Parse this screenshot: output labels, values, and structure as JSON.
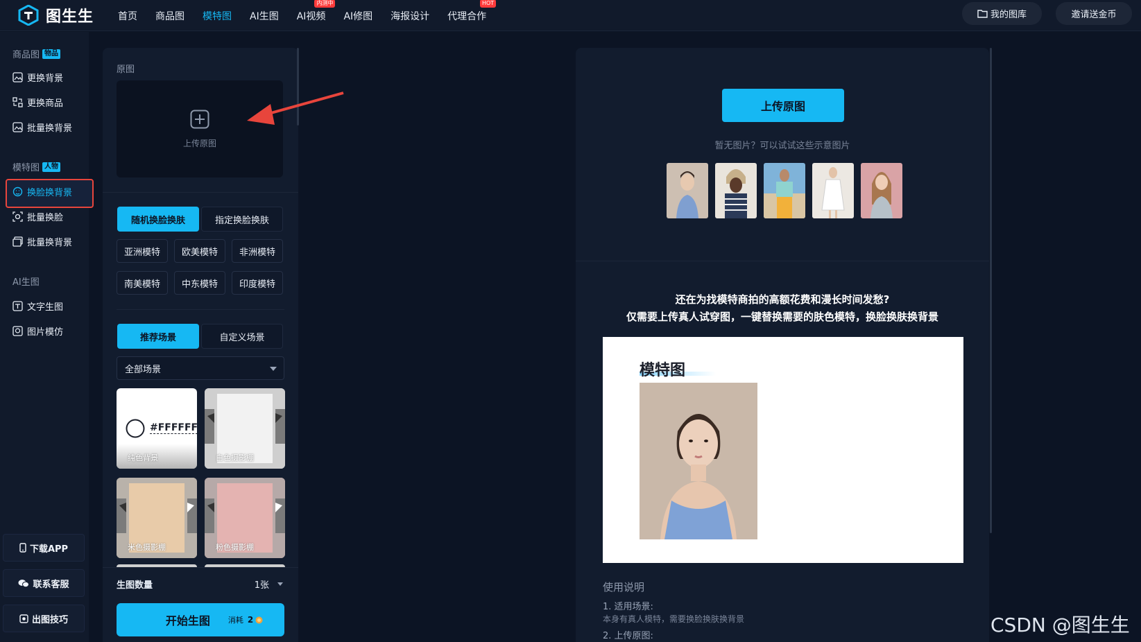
{
  "logo": {
    "text": "图生生"
  },
  "nav": {
    "items": [
      {
        "label": "首页"
      },
      {
        "label": "商品图"
      },
      {
        "label": "模特图"
      },
      {
        "label": "AI生图"
      },
      {
        "label": "AI视频",
        "badge": "内测中"
      },
      {
        "label": "AI修图"
      },
      {
        "label": "海报设计"
      },
      {
        "label": "代理合作",
        "badge": "HOT"
      }
    ],
    "active_index": 2
  },
  "top_right": {
    "my_library": "我的图库",
    "invite": "邀请送金币"
  },
  "sidebar": {
    "sections": [
      {
        "title": "商品图",
        "tag": "物品"
      },
      {
        "title": "模特图",
        "tag": "人物"
      },
      {
        "title": "AI生图"
      }
    ],
    "items": [
      {
        "label": "更换背景",
        "icon": "image-edit-icon"
      },
      {
        "label": "更换商品",
        "icon": "swap-icon"
      },
      {
        "label": "批量换背景",
        "icon": "image-edit-icon"
      },
      {
        "label": "换脸换背景",
        "icon": "face-swap-icon"
      },
      {
        "label": "批量换脸",
        "icon": "face-scan-icon"
      },
      {
        "label": "批量换背景",
        "icon": "images-icon"
      },
      {
        "label": "文字生图",
        "icon": "text-image-icon"
      },
      {
        "label": "图片模仿",
        "icon": "image-copy-icon"
      }
    ],
    "active_item": 3,
    "bottom": {
      "download": "下载APP",
      "contact": "联系客服",
      "tips": "出图技巧"
    }
  },
  "left_panel": {
    "original_label": "原图",
    "upload_text": "上传原图",
    "mode_tabs": [
      "随机换脸换肤",
      "指定换脸换肤"
    ],
    "model_chips": [
      "亚洲模特",
      "欧美模特",
      "非洲模特",
      "南美模特",
      "中东模特",
      "印度模特"
    ],
    "scene_tabs": [
      "推荐场景",
      "自定义场景"
    ],
    "scene_select": "全部场景",
    "scenes": [
      {
        "caption": "纯色背景",
        "hex": "#FFFFFF",
        "color": "#ffffff"
      },
      {
        "caption": "白色摄影棚",
        "color": "#e9e9e9"
      },
      {
        "caption": "米色摄影棚",
        "color": "#e6c9a8"
      },
      {
        "caption": "粉色摄影棚",
        "color": "#e3b2b0"
      }
    ],
    "count_label": "生图数量",
    "count_value": "1张",
    "start_label": "开始生图",
    "cost_label": "消耗",
    "cost_value": "2"
  },
  "right_panel": {
    "upload_button": "上传原图",
    "hint": "暂无图片？可以试试这些示意图片",
    "headline1": "还在为找模特商拍的高额花费和漫长时间发愁?",
    "headline2": "仅需要上传真人试穿图，一键替换需要的肤色模特，换脸换肤换背景",
    "demo_title": "模特图",
    "usage_title": "使用说明",
    "usage_1": "1. 适用场景:",
    "usage_1_desc": "本身有真人模特，需要换脸换肤换背景",
    "usage_2": "2. 上传原图:"
  },
  "watermark": "CSDN @图生生",
  "colors": {
    "accent": "#16b8f3",
    "background": "#0c1424",
    "panel": "#121c2e",
    "highlight": "#e8453c"
  }
}
